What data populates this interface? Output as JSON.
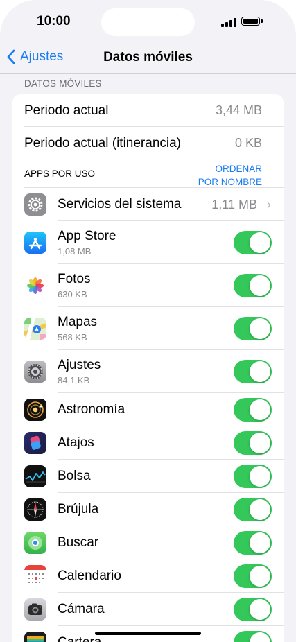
{
  "status": {
    "time": "10:00"
  },
  "nav": {
    "back_label": "Ajustes",
    "title": "Datos móviles"
  },
  "section_header": "DATOS MÓVILES",
  "usage": [
    {
      "label": "Periodo actual",
      "value": "3,44 MB"
    },
    {
      "label": "Periodo actual (itinerancia)",
      "value": "0 KB"
    }
  ],
  "apps_header": {
    "label": "APPS POR USO",
    "sort_line1": "ORDENAR",
    "sort_line2": "POR NOMBRE"
  },
  "system_services": {
    "label": "Servicios del sistema",
    "value": "1,11 MB"
  },
  "apps": [
    {
      "name": "App Store",
      "size": "1,08 MB",
      "icon": "app-store-icon",
      "enabled": true
    },
    {
      "name": "Fotos",
      "size": "630 KB",
      "icon": "photos-icon",
      "enabled": true
    },
    {
      "name": "Mapas",
      "size": "568 KB",
      "icon": "maps-icon",
      "enabled": true
    },
    {
      "name": "Ajustes",
      "size": "84,1 KB",
      "icon": "settings-icon",
      "enabled": true
    },
    {
      "name": "Astronomía",
      "icon": "astronomy-icon",
      "enabled": true
    },
    {
      "name": "Atajos",
      "icon": "shortcuts-icon",
      "enabled": true
    },
    {
      "name": "Bolsa",
      "icon": "stocks-icon",
      "enabled": true
    },
    {
      "name": "Brújula",
      "icon": "compass-icon",
      "enabled": true
    },
    {
      "name": "Buscar",
      "icon": "find-my-icon",
      "enabled": true
    },
    {
      "name": "Calendario",
      "icon": "calendar-icon",
      "enabled": true
    },
    {
      "name": "Cámara",
      "icon": "camera-icon",
      "enabled": true
    },
    {
      "name": "Cartera",
      "icon": "wallet-icon",
      "enabled": true
    }
  ],
  "colors": {
    "accent": "#1a7cf2",
    "toggle_on": "#34c759",
    "background": "#f2f2f7"
  }
}
